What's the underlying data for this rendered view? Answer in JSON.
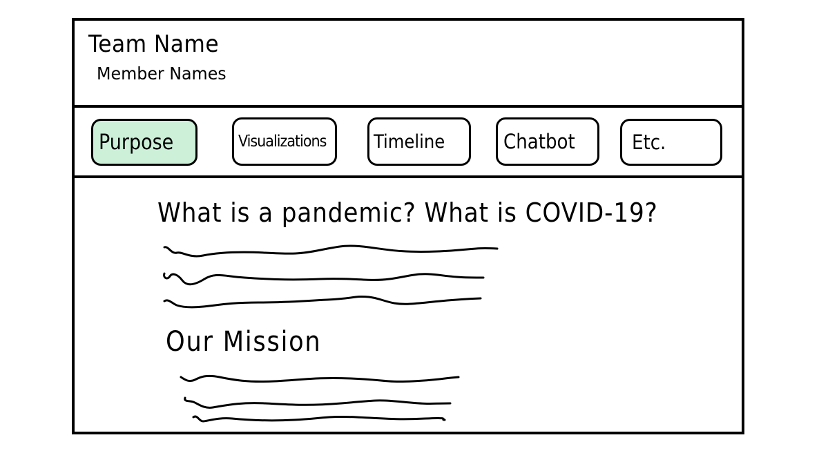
{
  "header": {
    "team_name": "Team Name",
    "member_names": "Member Names"
  },
  "nav": {
    "tabs": [
      {
        "label": "Purpose",
        "active": true
      },
      {
        "label": "Visualizations",
        "active": false
      },
      {
        "label": "Timeline",
        "active": false
      },
      {
        "label": "Chatbot",
        "active": false
      },
      {
        "label": "Etc.",
        "active": false
      }
    ]
  },
  "content": {
    "question_heading": "What is a pandemic? What is COVID-19?",
    "mission_heading": "Our Mission"
  },
  "colors": {
    "active_tab_fill": "#ccf0d8",
    "ink": "#000000",
    "background": "#ffffff"
  }
}
